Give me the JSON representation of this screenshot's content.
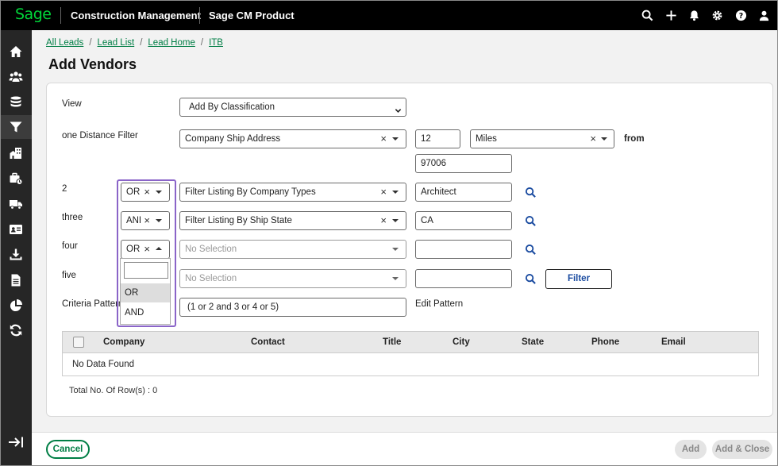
{
  "topbar": {
    "logo": "Sage",
    "app_title": "Construction Management",
    "product": "Sage CM Product",
    "icons": [
      "search-icon",
      "plus-icon",
      "bell-icon",
      "gear-icon",
      "help-icon",
      "user-icon"
    ]
  },
  "sidebar": {
    "icons": [
      "home-icon",
      "people-icon",
      "database-icon",
      "filter-icon",
      "buildings-icon",
      "briefcase-icon",
      "truck-icon",
      "id-card-icon",
      "download-icon",
      "document-icon",
      "pie-chart-icon",
      "refresh-icon"
    ],
    "active": "filter-icon",
    "collapse_icon": "collapse-arrow-icon"
  },
  "breadcrumb": {
    "items": [
      "All Leads",
      "Lead List",
      "Lead Home",
      "ITB"
    ],
    "separator": "/"
  },
  "page_title": "Add Vendors",
  "form": {
    "view_label": "View",
    "view_value": "Add By Classification",
    "rows": [
      {
        "label": "one Distance Filter",
        "filter": "Company Ship Address",
        "value": "12",
        "unit": "Miles",
        "from_label": "from",
        "from_value": "97006"
      },
      {
        "label": "2",
        "op": "OR",
        "filter": "Filter Listing By Company Types",
        "value": "Architect"
      },
      {
        "label": "three",
        "op": "AND",
        "filter": "Filter Listing By Ship State",
        "value": "CA"
      },
      {
        "label": "four",
        "op": "OR",
        "filter": "No Selection",
        "value": ""
      },
      {
        "label": "five",
        "op": "",
        "filter": "No Selection",
        "value": ""
      }
    ],
    "filter_button": "Filter",
    "criteria_label": "Criteria Pattern",
    "criteria_value": "(1 or 2 and 3 or 4 or 5)",
    "edit_pattern": "Edit Pattern"
  },
  "op_dropdown": {
    "search_value": "",
    "options": [
      "OR",
      "AND"
    ],
    "selected": "OR"
  },
  "table": {
    "columns": [
      "Company",
      "Contact",
      "Title",
      "City",
      "State",
      "Phone",
      "Email"
    ],
    "empty_text": "No Data Found",
    "total_text": "Total No. Of Row(s) : 0"
  },
  "footer": {
    "cancel": "Cancel",
    "add": "Add",
    "add_close": "Add & Close"
  },
  "colors": {
    "brand_green": "#00d639",
    "link_green": "#007e45",
    "highlight_purple": "#8a64c8",
    "search_blue": "#1a4ba0"
  }
}
